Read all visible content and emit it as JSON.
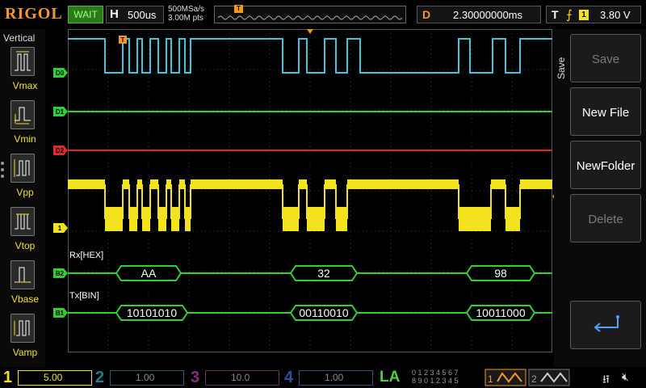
{
  "brand": "RIGOL",
  "status": "WAIT",
  "horizontal": {
    "key": "H",
    "timebase": "500us",
    "sample_rate": "500MSa/s",
    "memory_depth": "3.00M pts"
  },
  "trigger_marker": "T",
  "delay": {
    "key": "D",
    "value": "2.30000000ms"
  },
  "trigger": {
    "key": "T",
    "edge_icon": "rising-edge-icon",
    "source": "1",
    "level": "3.80 V"
  },
  "measure": {
    "title": "Vertical",
    "items": [
      "Vmax",
      "Vmin",
      "Vpp",
      "Vtop",
      "Vbase",
      "Vamp"
    ]
  },
  "save_menu": {
    "title": "Save",
    "buttons": [
      {
        "label": "Save",
        "enabled": false
      },
      {
        "label": "New File",
        "enabled": true
      },
      {
        "label": "NewFolder",
        "enabled": true
      },
      {
        "label": "Delete",
        "enabled": false
      },
      {
        "label": "",
        "icon": "return-arrow-icon",
        "enabled": true
      }
    ]
  },
  "traces": {
    "d0": "D0",
    "d1": "D1",
    "d2": "D2",
    "ch1": "1",
    "b2": "B2",
    "b1": "B1"
  },
  "decoders": {
    "rx_label": "Rx[HEX]",
    "tx_label": "Tx[BIN]",
    "rx": [
      "AA",
      "32",
      "98"
    ],
    "tx": [
      "10101010",
      "00110010",
      "10011000"
    ]
  },
  "channels": [
    {
      "num": "1",
      "scale": "5.00 V",
      "color": "#f3e21e",
      "active": true
    },
    {
      "num": "2",
      "scale": "1.00 V",
      "color": "#2bd3e8",
      "active": false
    },
    {
      "num": "3",
      "scale": "10.0 V",
      "color": "#d23cd2",
      "active": false
    },
    {
      "num": "4",
      "scale": "1.00 V",
      "color": "#3b6fe0",
      "active": false
    }
  ],
  "la": {
    "label": "LA",
    "row1": "0 1 2 3  4 5 6 7",
    "row2": "8 9 0 1  2 3 4 5"
  },
  "generators": [
    "1",
    "2"
  ],
  "colors": {
    "accent": "#f39a1e",
    "ch1": "#f3e21e",
    "digital": "#2fd12f",
    "d2": "#e02a2a",
    "d0_high": "#3cc7e0"
  }
}
